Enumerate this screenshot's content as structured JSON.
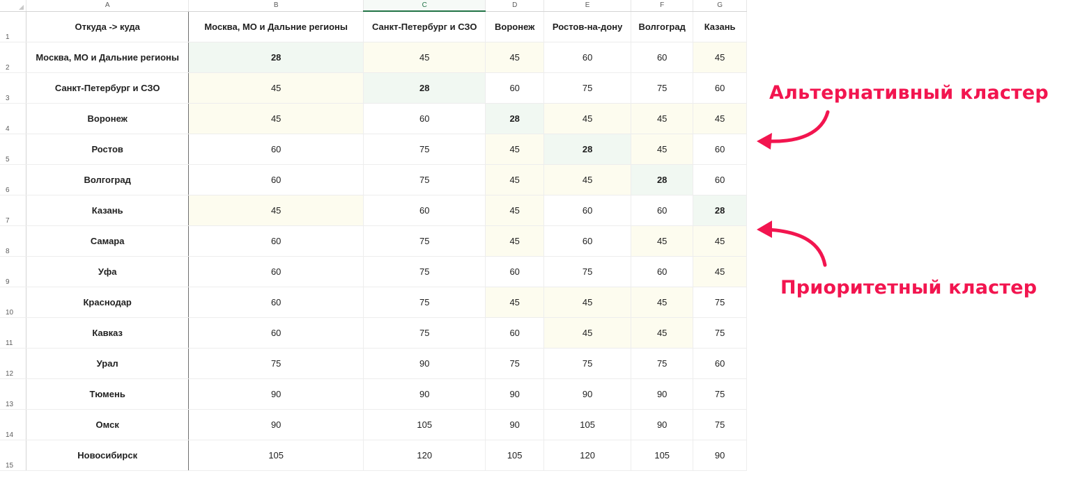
{
  "columns": [
    "A",
    "B",
    "C",
    "D",
    "E",
    "F",
    "G"
  ],
  "header_label": "Откуда -> куда",
  "destinations": [
    "Москва, МО и Дальние регионы",
    "Санкт-Петербург и СЗО",
    "Воронеж",
    "Ростов-на-дону",
    "Волгоград",
    "Казань"
  ],
  "rows": [
    {
      "num": "2",
      "label": "Москва, МО и Дальние регионы",
      "values": [
        "28",
        "45",
        "45",
        "60",
        "60",
        "45"
      ],
      "fill": [
        "g",
        "y",
        "y",
        "",
        "",
        "y"
      ]
    },
    {
      "num": "3",
      "label": "Санкт-Петербург и СЗО",
      "values": [
        "45",
        "28",
        "60",
        "75",
        "75",
        "60"
      ],
      "fill": [
        "y",
        "g",
        "",
        "",
        "",
        ""
      ]
    },
    {
      "num": "4",
      "label": "Воронеж",
      "values": [
        "45",
        "60",
        "28",
        "45",
        "45",
        "45"
      ],
      "fill": [
        "y",
        "",
        "g",
        "y",
        "y",
        "y"
      ]
    },
    {
      "num": "5",
      "label": "Ростов",
      "values": [
        "60",
        "75",
        "45",
        "28",
        "45",
        "60"
      ],
      "fill": [
        "",
        "",
        "y",
        "g",
        "y",
        ""
      ]
    },
    {
      "num": "6",
      "label": "Волгоград",
      "values": [
        "60",
        "75",
        "45",
        "45",
        "28",
        "60"
      ],
      "fill": [
        "",
        "",
        "y",
        "y",
        "g",
        ""
      ]
    },
    {
      "num": "7",
      "label": "Казань",
      "values": [
        "45",
        "60",
        "45",
        "60",
        "60",
        "28"
      ],
      "fill": [
        "y",
        "",
        "y",
        "",
        "",
        "g"
      ]
    },
    {
      "num": "8",
      "label": "Самара",
      "values": [
        "60",
        "75",
        "45",
        "60",
        "45",
        "45"
      ],
      "fill": [
        "",
        "",
        "y",
        "",
        "y",
        "y"
      ]
    },
    {
      "num": "9",
      "label": "Уфа",
      "values": [
        "60",
        "75",
        "60",
        "75",
        "60",
        "45"
      ],
      "fill": [
        "",
        "",
        "",
        "",
        "",
        "y"
      ]
    },
    {
      "num": "10",
      "label": "Краснодар",
      "values": [
        "60",
        "75",
        "45",
        "45",
        "45",
        "75"
      ],
      "fill": [
        "",
        "",
        "y",
        "y",
        "y",
        ""
      ]
    },
    {
      "num": "11",
      "label": "Кавказ",
      "values": [
        "60",
        "75",
        "60",
        "45",
        "45",
        "75"
      ],
      "fill": [
        "",
        "",
        "",
        "y",
        "y",
        ""
      ]
    },
    {
      "num": "12",
      "label": "Урал",
      "values": [
        "75",
        "90",
        "75",
        "75",
        "75",
        "60"
      ],
      "fill": [
        "",
        "",
        "",
        "",
        "",
        ""
      ]
    },
    {
      "num": "13",
      "label": "Тюмень",
      "values": [
        "90",
        "90",
        "90",
        "90",
        "90",
        "75"
      ],
      "fill": [
        "",
        "",
        "",
        "",
        "",
        ""
      ]
    },
    {
      "num": "14",
      "label": "Омск",
      "values": [
        "90",
        "105",
        "90",
        "105",
        "90",
        "75"
      ],
      "fill": [
        "",
        "",
        "",
        "",
        "",
        ""
      ]
    },
    {
      "num": "15",
      "label": "Новосибирск",
      "values": [
        "105",
        "120",
        "105",
        "120",
        "105",
        "90"
      ],
      "fill": [
        "",
        "",
        "",
        "",
        "",
        ""
      ]
    }
  ],
  "annotations": {
    "alternative": "Альтернативный кластер",
    "priority": "Приоритетный кластер"
  },
  "colors": {
    "accent": "#f2154f",
    "highlight_yellow": "#fdfcef",
    "highlight_green": "#f1f8f2",
    "selected_header": "#217346"
  }
}
